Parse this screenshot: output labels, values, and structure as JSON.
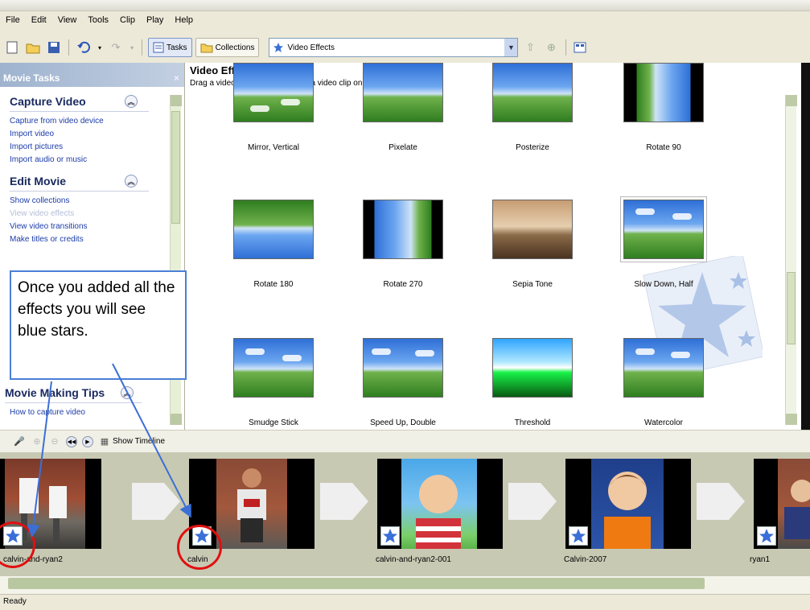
{
  "menu": [
    "File",
    "Edit",
    "View",
    "Tools",
    "Clip",
    "Play",
    "Help"
  ],
  "toolbar": {
    "tasks_label": "Tasks",
    "collections_label": "Collections",
    "location_value": "Video Effects"
  },
  "tasks_pane": {
    "header": "Movie Tasks",
    "close": "×",
    "capture": {
      "title": "Capture Video",
      "links": [
        "Capture from video device",
        "Import video",
        "Import pictures",
        "Import audio or music"
      ]
    },
    "edit": {
      "title": "Edit Movie",
      "links": [
        "Show collections",
        "View video effects",
        "View video transitions",
        "Make titles or credits"
      ]
    },
    "tips": {
      "title": "Movie Making Tips",
      "links": [
        "How to capture video"
      ]
    }
  },
  "effects_pane": {
    "title": "Video Effects",
    "subtitle": "Drag a video effect and drop it on a video clip on the storyboard below.",
    "items": [
      "Mirror, Vertical",
      "Pixelate",
      "Posterize",
      "Rotate 90",
      "Rotate 180",
      "Rotate 270",
      "Sepia Tone",
      "Slow Down, Half",
      "Smudge Stick",
      "Speed Up, Double",
      "Threshold",
      "Watercolor"
    ]
  },
  "storyboard_toolbar": {
    "show_timeline": "Show Timeline"
  },
  "clips": [
    "calvin-and-ryan2",
    "calvin",
    "calvin-and-ryan2-001",
    "Calvin-2007",
    "ryan1"
  ],
  "callout": {
    "text": "Once you added all the effects you will see blue stars."
  },
  "status": {
    "text": "Ready"
  },
  "colors": {
    "link": "#1c3ca8",
    "callout_border": "#4a7fd8",
    "annotation_red": "#e01010",
    "star_blue": "#3a6fd8"
  }
}
